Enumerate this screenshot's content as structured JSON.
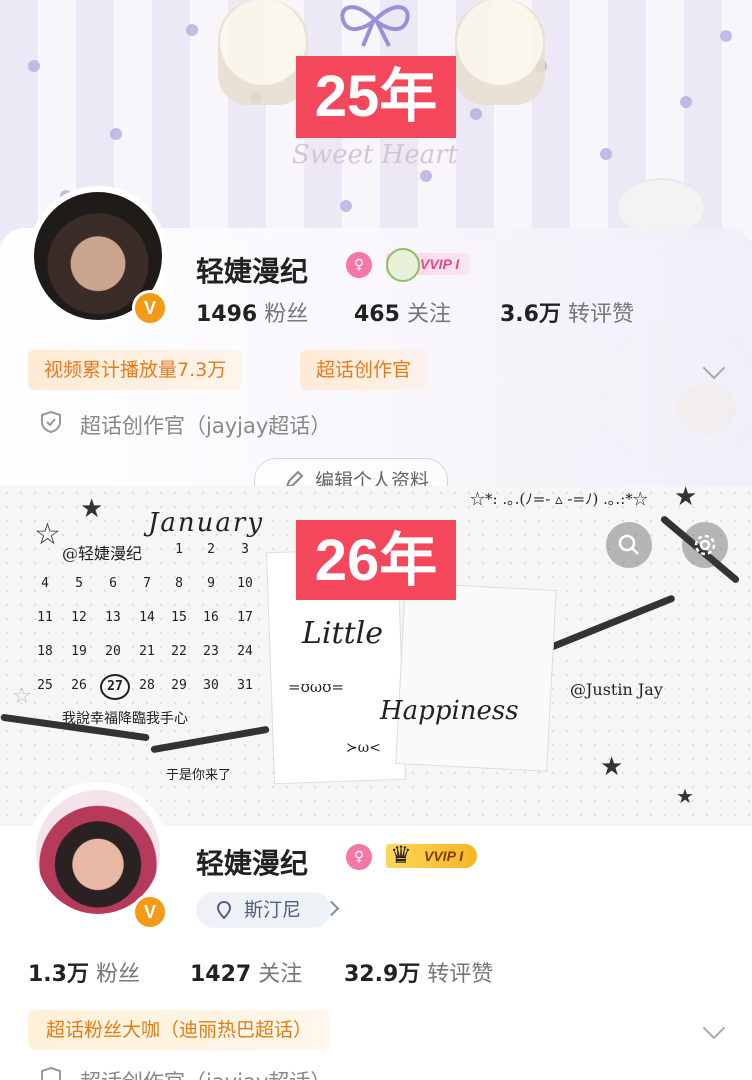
{
  "before": {
    "year_label": "25年",
    "banner_script": "Sweet Heart",
    "username": "轻婕漫纪",
    "vip_label": "VVIP I",
    "stats": [
      {
        "num": "1496",
        "label": "粉丝"
      },
      {
        "num": "465",
        "label": "关注"
      },
      {
        "num": "3.6万",
        "label": "转评赞"
      }
    ],
    "tags": [
      "视频累计播放量7.3万",
      "超话创作官"
    ],
    "role_text": "超话创作官（jayjay超话）",
    "edit_button": "编辑个人资料"
  },
  "after": {
    "year_label": "26年",
    "calendar": {
      "month": "January",
      "handle": "@轻婕漫纪",
      "header_days": [
        "1",
        "2",
        "3"
      ],
      "rows": [
        [
          "4",
          "5",
          "6",
          "7",
          "8",
          "9",
          "10"
        ],
        [
          "11",
          "12",
          "13",
          "14",
          "15",
          "16",
          "17"
        ],
        [
          "18",
          "19",
          "20",
          "21",
          "22",
          "23",
          "24"
        ],
        [
          "25",
          "26",
          "27",
          "28",
          "29",
          "30",
          "31"
        ]
      ],
      "highlight": "27",
      "caption1": "我說幸福降臨我手心",
      "caption2": "于是你来了"
    },
    "note_texts": {
      "little": "Little",
      "happiness": "Happiness",
      "face1": "=ʊωʊ=",
      "face2": "≻ω<",
      "kaomoji": "☆*: .｡.(ﾉ=- ▵ -=ﾉ) .｡.:*☆",
      "credit": "@Justin Jay"
    },
    "username": "轻婕漫纪",
    "vip_label": "VVIP I",
    "location": "斯汀尼",
    "stats": [
      {
        "num": "1.3万",
        "label": "粉丝"
      },
      {
        "num": "1427",
        "label": "关注"
      },
      {
        "num": "32.9万",
        "label": "转评赞"
      }
    ],
    "tag": "超话粉丝大咖（迪丽热巴超话）",
    "role_text": "超话创作官（jayjay超话）"
  },
  "icons": [
    "search-icon",
    "settings-icon",
    "shield-icon",
    "pencil-icon",
    "chevron-down-icon",
    "location-icon"
  ],
  "colors": {
    "badge_red": "#f4475b",
    "tag_orange": "#e57b14",
    "vip_gold": "#f6b621",
    "verified": "#f39a17"
  }
}
